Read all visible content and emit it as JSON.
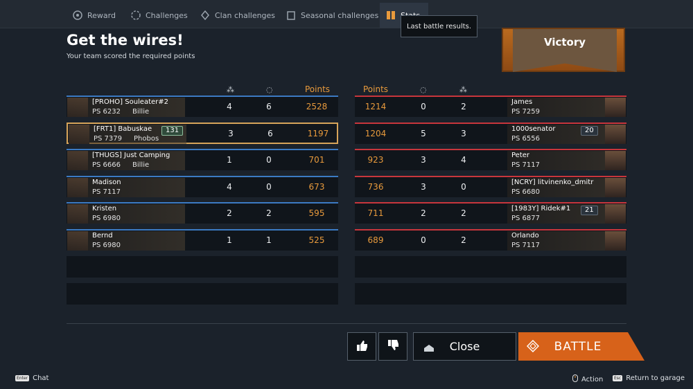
{
  "tabs": [
    {
      "label": "Reward",
      "icon": "reward-icon"
    },
    {
      "label": "Challenges",
      "icon": "challenges-icon"
    },
    {
      "label": "Clan challenges",
      "icon": "clan-icon"
    },
    {
      "label": "Seasonal challenges",
      "icon": "seasonal-icon"
    },
    {
      "label": "Stats",
      "icon": "stats-icon"
    }
  ],
  "tooltip": "Last battle results.",
  "title": "Get the wires!",
  "subtitle": "Your team scored the required points",
  "result": "Victory",
  "headers": {
    "points_left": "Points",
    "points_right": "Points"
  },
  "team_left": [
    {
      "name": "[PROHO] Souleater#2",
      "ps": "PS 6232",
      "companion": "Billie",
      "kills": "4",
      "assists": "6",
      "points": "2528"
    },
    {
      "name": "[FRT1] Babuskae",
      "ps": "PS 7379",
      "companion": "Phobos",
      "badge": "131",
      "kills": "3",
      "assists": "6",
      "points": "1197"
    },
    {
      "name": "[THUGS] Just Camping",
      "ps": "PS 6666",
      "companion": "Billie",
      "kills": "1",
      "assists": "0",
      "points": "701"
    },
    {
      "name": "Madison",
      "ps": "PS 7117",
      "kills": "4",
      "assists": "0",
      "points": "673"
    },
    {
      "name": "Kristen",
      "ps": "PS 6980",
      "kills": "2",
      "assists": "2",
      "points": "595"
    },
    {
      "name": "Bernd",
      "ps": "PS 6980",
      "kills": "1",
      "assists": "1",
      "points": "525"
    }
  ],
  "team_right": [
    {
      "name": "James",
      "ps": "PS 7259",
      "kills": "2",
      "assists": "0",
      "points": "1214"
    },
    {
      "name": "1000senator",
      "ps": "PS 6556",
      "badge": "20",
      "kills": "3",
      "assists": "5",
      "points": "1204"
    },
    {
      "name": "Peter",
      "ps": "PS 7117",
      "kills": "4",
      "assists": "3",
      "points": "923"
    },
    {
      "name": "[NCRY] litvinenko_dmitr",
      "ps": "PS 6680",
      "kills": "0",
      "assists": "3",
      "points": "736"
    },
    {
      "name": "[1983Y] Ridek#1",
      "ps": "PS 6877",
      "badge": "21",
      "kills": "2",
      "assists": "2",
      "points": "711"
    },
    {
      "name": "Orlando",
      "ps": "PS 7117",
      "kills": "2",
      "assists": "0",
      "points": "689"
    }
  ],
  "buttons": {
    "close": "Close",
    "battle": "BATTLE"
  },
  "footer": {
    "chat_key": "Enter",
    "chat": "Chat",
    "action": "Action",
    "esc_key": "Esc",
    "return": "Return to garage"
  },
  "colors": {
    "accent": "#d7621a",
    "points": "#e89a3c",
    "ally": "#3c7bc4",
    "enemy": "#c9363c"
  }
}
